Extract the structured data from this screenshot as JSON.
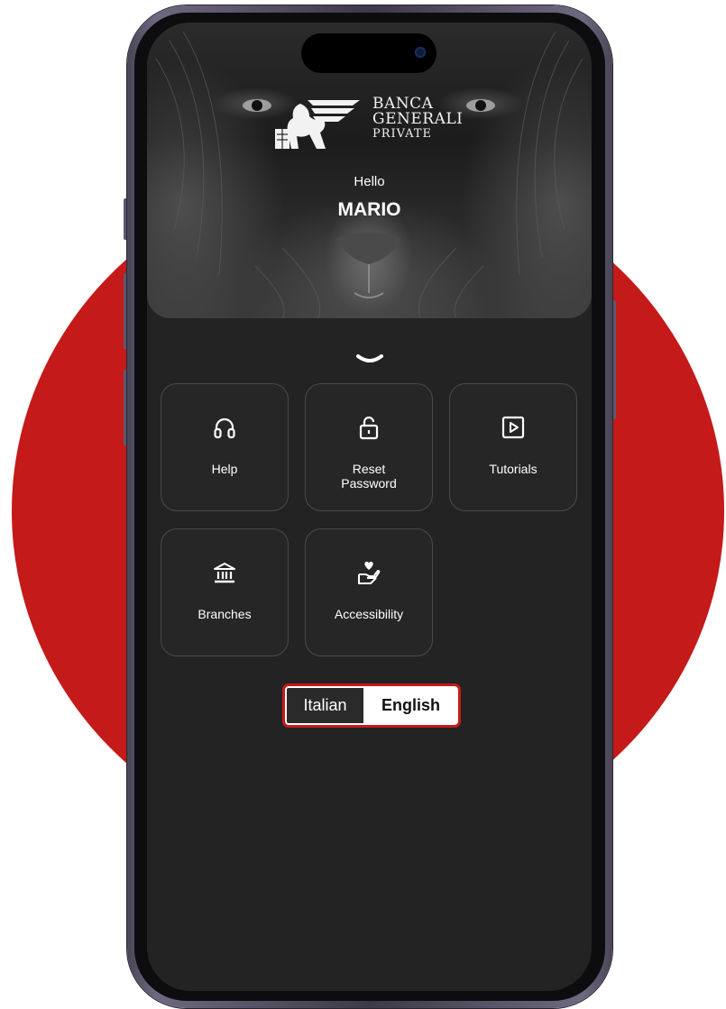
{
  "brand": {
    "logo_lines": [
      "BANCA",
      "GENERALI",
      "PRIVATE"
    ],
    "logo_icon": "winged-lion-icon"
  },
  "header": {
    "greeting": "Hello",
    "username": "MARIO"
  },
  "expand_icon": "chevron-down-icon",
  "tiles": [
    {
      "label": "Help",
      "icon": "headset-icon"
    },
    {
      "label": "Reset\nPassword",
      "icon": "unlock-icon"
    },
    {
      "label": "Tutorials",
      "icon": "play-square-icon"
    },
    {
      "label": "Branches",
      "icon": "bank-icon"
    },
    {
      "label": "Accessibility",
      "icon": "heart-hand-icon"
    }
  ],
  "language": {
    "options": [
      "Italian",
      "English"
    ],
    "selected": "English"
  },
  "colors": {
    "accent_red": "#c41a19",
    "screen_bg": "#232323",
    "tile_border": "#4a4a4a"
  }
}
